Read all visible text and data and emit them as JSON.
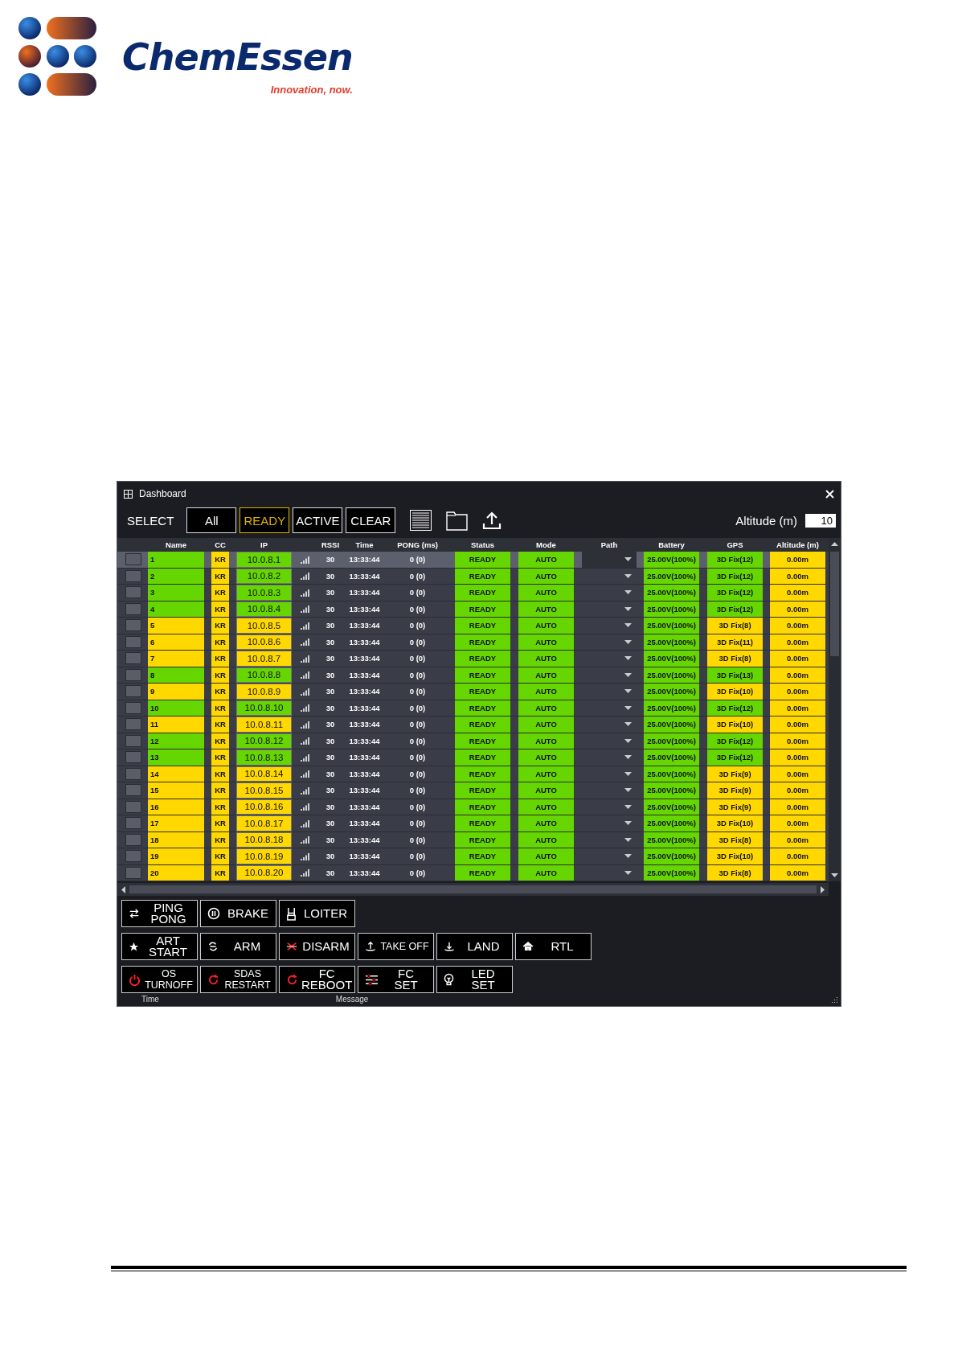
{
  "logo": {
    "name": "ChemEssen",
    "tagline": "Innovation, now."
  },
  "window": {
    "title": "Dashboard"
  },
  "toolbar": {
    "select_label": "SELECT",
    "filters": [
      {
        "label": "All",
        "selected": false
      },
      {
        "label": "READY",
        "selected": true
      },
      {
        "label": "ACTIVE",
        "selected": false
      },
      {
        "label": "CLEAR",
        "selected": false
      }
    ],
    "altitude_label": "Altitude (m)",
    "altitude_value": "10"
  },
  "table": {
    "columns": [
      "Name",
      "CC",
      "IP",
      "RSSI",
      "Time",
      "PONG (ms)",
      "Status",
      "Mode",
      "Path",
      "Battery",
      "GPS",
      "Altitude (m)"
    ],
    "rows": [
      {
        "selected": true,
        "checked": false,
        "name": "1",
        "color": "#66d600",
        "cc": "KR",
        "ip": "10.0.8.1",
        "rssi": "30",
        "time": "13:33:44",
        "pong": "0 (0)",
        "status": "READY",
        "mode": "AUTO",
        "battery": "25.00V(100%)",
        "gps": {
          "text": "3D Fix(12)",
          "color": "#66d600"
        },
        "altitude": "0.00m"
      },
      {
        "selected": false,
        "checked": false,
        "name": "2",
        "color": "#66d600",
        "cc": "KR",
        "ip": "10.0.8.2",
        "rssi": "30",
        "time": "13:33:44",
        "pong": "0 (0)",
        "status": "READY",
        "mode": "AUTO",
        "battery": "25.00V(100%)",
        "gps": {
          "text": "3D Fix(12)",
          "color": "#66d600"
        },
        "altitude": "0.00m"
      },
      {
        "selected": false,
        "checked": false,
        "name": "3",
        "color": "#66d600",
        "cc": "KR",
        "ip": "10.0.8.3",
        "rssi": "30",
        "time": "13:33:44",
        "pong": "0 (0)",
        "status": "READY",
        "mode": "AUTO",
        "battery": "25.00V(100%)",
        "gps": {
          "text": "3D Fix(12)",
          "color": "#66d600"
        },
        "altitude": "0.00m"
      },
      {
        "selected": false,
        "checked": false,
        "name": "4",
        "color": "#66d600",
        "cc": "KR",
        "ip": "10.0.8.4",
        "rssi": "30",
        "time": "13:33:44",
        "pong": "0 (0)",
        "status": "READY",
        "mode": "AUTO",
        "battery": "25.00V(100%)",
        "gps": {
          "text": "3D Fix(12)",
          "color": "#66d600"
        },
        "altitude": "0.00m"
      },
      {
        "selected": false,
        "checked": false,
        "name": "5",
        "color": "#ffd800",
        "cc": "KR",
        "ip": "10.0.8.5",
        "rssi": "30",
        "time": "13:33:44",
        "pong": "0 (0)",
        "status": "READY",
        "mode": "AUTO",
        "battery": "25.00V(100%)",
        "gps": {
          "text": "3D Fix(8)",
          "color": "#ffd800"
        },
        "altitude": "0.00m"
      },
      {
        "selected": false,
        "checked": false,
        "name": "6",
        "color": "#ffd800",
        "cc": "KR",
        "ip": "10.0.8.6",
        "rssi": "30",
        "time": "13:33:44",
        "pong": "0 (0)",
        "status": "READY",
        "mode": "AUTO",
        "battery": "25.00V(100%)",
        "gps": {
          "text": "3D Fix(11)",
          "color": "#ffd800"
        },
        "altitude": "0.00m"
      },
      {
        "selected": false,
        "checked": false,
        "name": "7",
        "color": "#ffd800",
        "cc": "KR",
        "ip": "10.0.8.7",
        "rssi": "30",
        "time": "13:33:44",
        "pong": "0 (0)",
        "status": "READY",
        "mode": "AUTO",
        "battery": "25.00V(100%)",
        "gps": {
          "text": "3D Fix(8)",
          "color": "#ffd800"
        },
        "altitude": "0.00m"
      },
      {
        "selected": false,
        "checked": false,
        "name": "8",
        "color": "#66d600",
        "cc": "KR",
        "ip": "10.0.8.8",
        "rssi": "30",
        "time": "13:33:44",
        "pong": "0 (0)",
        "status": "READY",
        "mode": "AUTO",
        "battery": "25.00V(100%)",
        "gps": {
          "text": "3D Fix(13)",
          "color": "#66d600"
        },
        "altitude": "0.00m"
      },
      {
        "selected": false,
        "checked": false,
        "name": "9",
        "color": "#ffd800",
        "cc": "KR",
        "ip": "10.0.8.9",
        "rssi": "30",
        "time": "13:33:44",
        "pong": "0 (0)",
        "status": "READY",
        "mode": "AUTO",
        "battery": "25.00V(100%)",
        "gps": {
          "text": "3D Fix(10)",
          "color": "#ffd800"
        },
        "altitude": "0.00m"
      },
      {
        "selected": false,
        "checked": false,
        "name": "10",
        "color": "#66d600",
        "cc": "KR",
        "ip": "10.0.8.10",
        "rssi": "30",
        "time": "13:33:44",
        "pong": "0 (0)",
        "status": "READY",
        "mode": "AUTO",
        "battery": "25.00V(100%)",
        "gps": {
          "text": "3D Fix(12)",
          "color": "#66d600"
        },
        "altitude": "0.00m"
      },
      {
        "selected": false,
        "checked": false,
        "name": "11",
        "color": "#ffd800",
        "cc": "KR",
        "ip": "10.0.8.11",
        "rssi": "30",
        "time": "13:33:44",
        "pong": "0 (0)",
        "status": "READY",
        "mode": "AUTO",
        "battery": "25.00V(100%)",
        "gps": {
          "text": "3D Fix(10)",
          "color": "#ffd800"
        },
        "altitude": "0.00m"
      },
      {
        "selected": false,
        "checked": false,
        "name": "12",
        "color": "#66d600",
        "cc": "KR",
        "ip": "10.0.8.12",
        "rssi": "30",
        "time": "13:33:44",
        "pong": "0 (0)",
        "status": "READY",
        "mode": "AUTO",
        "battery": "25.00V(100%)",
        "gps": {
          "text": "3D Fix(12)",
          "color": "#66d600"
        },
        "altitude": "0.00m"
      },
      {
        "selected": false,
        "checked": false,
        "name": "13",
        "color": "#66d600",
        "cc": "KR",
        "ip": "10.0.8.13",
        "rssi": "30",
        "time": "13:33:44",
        "pong": "0 (0)",
        "status": "READY",
        "mode": "AUTO",
        "battery": "25.00V(100%)",
        "gps": {
          "text": "3D Fix(12)",
          "color": "#66d600"
        },
        "altitude": "0.00m"
      },
      {
        "selected": false,
        "checked": false,
        "name": "14",
        "color": "#ffd800",
        "cc": "KR",
        "ip": "10.0.8.14",
        "rssi": "30",
        "time": "13:33:44",
        "pong": "0 (0)",
        "status": "READY",
        "mode": "AUTO",
        "battery": "25.00V(100%)",
        "gps": {
          "text": "3D Fix(9)",
          "color": "#ffd800"
        },
        "altitude": "0.00m"
      },
      {
        "selected": false,
        "checked": false,
        "name": "15",
        "color": "#ffd800",
        "cc": "KR",
        "ip": "10.0.8.15",
        "rssi": "30",
        "time": "13:33:44",
        "pong": "0 (0)",
        "status": "READY",
        "mode": "AUTO",
        "battery": "25.00V(100%)",
        "gps": {
          "text": "3D Fix(9)",
          "color": "#ffd800"
        },
        "altitude": "0.00m"
      },
      {
        "selected": false,
        "checked": false,
        "name": "16",
        "color": "#ffd800",
        "cc": "KR",
        "ip": "10.0.8.16",
        "rssi": "30",
        "time": "13:33:44",
        "pong": "0 (0)",
        "status": "READY",
        "mode": "AUTO",
        "battery": "25.00V(100%)",
        "gps": {
          "text": "3D Fix(9)",
          "color": "#ffd800"
        },
        "altitude": "0.00m"
      },
      {
        "selected": false,
        "checked": false,
        "name": "17",
        "color": "#ffd800",
        "cc": "KR",
        "ip": "10.0.8.17",
        "rssi": "30",
        "time": "13:33:44",
        "pong": "0 (0)",
        "status": "READY",
        "mode": "AUTO",
        "battery": "25.00V(100%)",
        "gps": {
          "text": "3D Fix(10)",
          "color": "#ffd800"
        },
        "altitude": "0.00m"
      },
      {
        "selected": false,
        "checked": false,
        "name": "18",
        "color": "#ffd800",
        "cc": "KR",
        "ip": "10.0.8.18",
        "rssi": "30",
        "time": "13:33:44",
        "pong": "0 (0)",
        "status": "READY",
        "mode": "AUTO",
        "battery": "25.00V(100%)",
        "gps": {
          "text": "3D Fix(8)",
          "color": "#ffd800"
        },
        "altitude": "0.00m"
      },
      {
        "selected": false,
        "checked": false,
        "name": "19",
        "color": "#ffd800",
        "cc": "KR",
        "ip": "10.0.8.19",
        "rssi": "30",
        "time": "13:33:44",
        "pong": "0 (0)",
        "status": "READY",
        "mode": "AUTO",
        "battery": "25.00V(100%)",
        "gps": {
          "text": "3D Fix(10)",
          "color": "#ffd800"
        },
        "altitude": "0.00m"
      },
      {
        "selected": false,
        "checked": false,
        "name": "20",
        "color": "#ffd800",
        "cc": "KR",
        "ip": "10.0.8.20",
        "rssi": "30",
        "time": "13:33:44",
        "pong": "0 (0)",
        "status": "READY",
        "mode": "AUTO",
        "battery": "25.00V(100%)",
        "gps": {
          "text": "3D Fix(8)",
          "color": "#ffd800"
        },
        "altitude": "0.00m"
      }
    ]
  },
  "actions": [
    [
      {
        "label": [
          "PING",
          "PONG"
        ],
        "kind": "swap"
      },
      {
        "label": [
          "BRAKE"
        ],
        "kind": "pause"
      },
      {
        "label": [
          "LOITER"
        ],
        "kind": "loiter"
      }
    ],
    [
      {
        "label": [
          "ART",
          "START"
        ],
        "kind": "star"
      },
      {
        "label": [
          "ARM"
        ],
        "kind": "arm"
      },
      {
        "label": [
          "DISARM"
        ],
        "kind": "disarm"
      },
      {
        "label": [
          "TAKE OFF"
        ],
        "kind": "takeoff"
      },
      {
        "label": [
          "LAND"
        ],
        "kind": "land"
      },
      {
        "label": [
          "RTL"
        ],
        "kind": "home"
      }
    ],
    [
      {
        "label": [
          "OS",
          "TURNOFF"
        ],
        "kind": "power"
      },
      {
        "label": [
          "SDAS",
          "RESTART"
        ],
        "kind": "restart"
      },
      {
        "label": [
          "FC",
          "REBOOT"
        ],
        "kind": "restart"
      },
      {
        "label": [
          "FC",
          "SET"
        ],
        "kind": "sliders"
      },
      {
        "label": [
          "LED",
          "SET"
        ],
        "kind": "bulb"
      }
    ]
  ],
  "log": {
    "columns": [
      "Time",
      "Message"
    ]
  }
}
